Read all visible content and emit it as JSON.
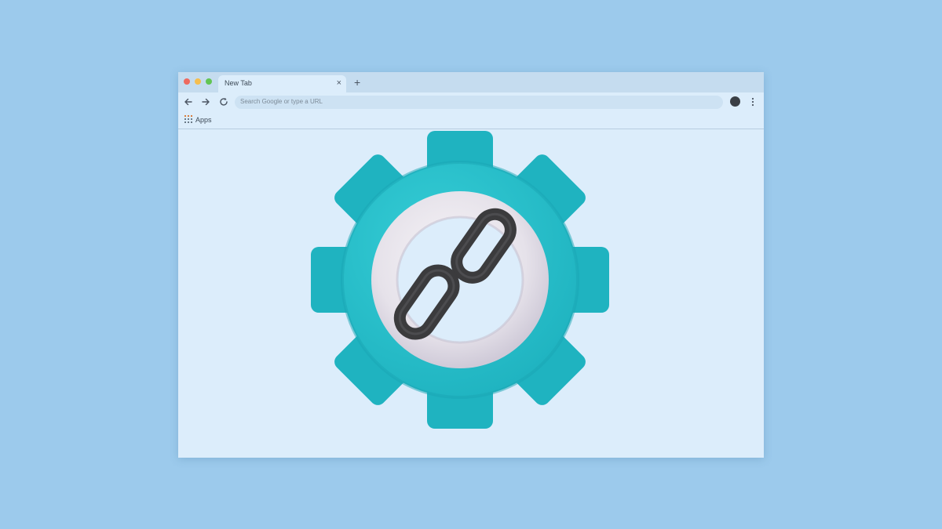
{
  "window": {
    "controls": [
      "close",
      "minimize",
      "maximize"
    ]
  },
  "tabs": [
    {
      "title": "New Tab",
      "active": true
    }
  ],
  "toolbar": {
    "back_icon": "arrow-left-icon",
    "forward_icon": "arrow-right-icon",
    "reload_icon": "reload-icon",
    "omnibox_placeholder": "Search Google or type a URL",
    "profile_icon": "profile-avatar-icon",
    "menu_icon": "kebab-menu-icon"
  },
  "bookmarks": {
    "apps_icon": "apps-grid-icon",
    "apps_label": "Apps"
  },
  "content": {
    "illustration": "gear-with-chain-link-icon",
    "colors": {
      "gear": "#27c0cd",
      "ring": "#ece9ee",
      "chain": "#3b3b3d"
    }
  },
  "colors": {
    "background": "#9ccaec",
    "browser": "#dcedfb",
    "tabbar": "#c5dcef"
  }
}
